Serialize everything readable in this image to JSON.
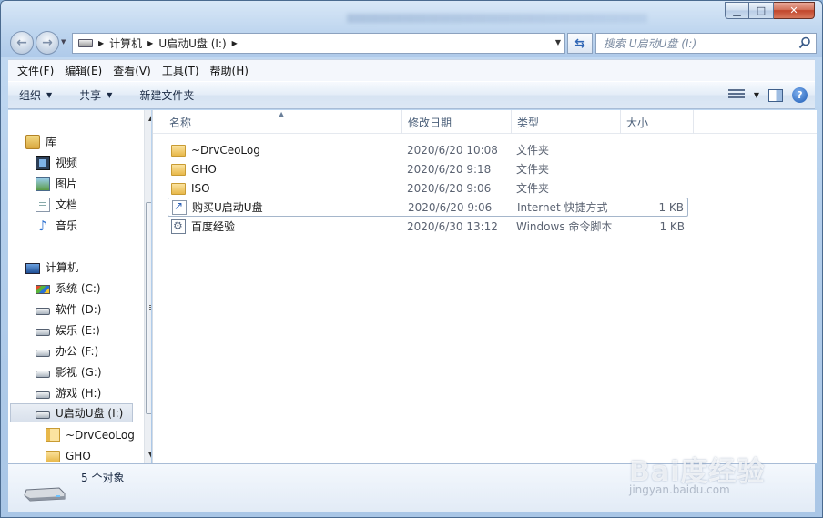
{
  "window": {
    "caption": {
      "minimize": "▁",
      "maximize": "□",
      "close": "✕"
    }
  },
  "navigation": {
    "address_segments": [
      "计算机",
      "U启动U盘 (I:)"
    ],
    "search_placeholder": "搜索 U启动U盘 (I:)"
  },
  "menu": [
    "文件(F)",
    "编辑(E)",
    "查看(V)",
    "工具(T)",
    "帮助(H)"
  ],
  "toolbar": {
    "organize": "组织",
    "share": "共享",
    "new_folder": "新建文件夹"
  },
  "tree": {
    "libraries": "库",
    "library_items": [
      "视频",
      "图片",
      "文档",
      "音乐"
    ],
    "computer": "计算机",
    "drives": [
      "系统 (C:)",
      "软件 (D:)",
      "娱乐 (E:)",
      "办公 (F:)",
      "影视 (G:)",
      "游戏 (H:)"
    ],
    "selected_drive": "U启动U盘 (I:)",
    "subfolders": [
      "~DrvCeoLog",
      "GHO"
    ]
  },
  "columns": {
    "name": "名称",
    "date": "修改日期",
    "type": "类型",
    "size": "大小"
  },
  "files": [
    {
      "name": "~DrvCeoLog",
      "date": "2020/6/20 10:08",
      "type": "文件夹",
      "size": "",
      "icon": "folder-icon"
    },
    {
      "name": "GHO",
      "date": "2020/6/20 9:18",
      "type": "文件夹",
      "size": "",
      "icon": "folder-icon"
    },
    {
      "name": "ISO",
      "date": "2020/6/20 9:06",
      "type": "文件夹",
      "size": "",
      "icon": "folder-icon"
    },
    {
      "name": "购买U启动U盘",
      "date": "2020/6/20 9:06",
      "type": "Internet 快捷方式",
      "size": "1 KB",
      "icon": "internet-shortcut-icon"
    },
    {
      "name": "百度经验",
      "date": "2020/6/30 13:12",
      "type": "Windows 命令脚本",
      "size": "1 KB",
      "icon": "command-script-icon"
    }
  ],
  "status": {
    "item_count": "5 个对象"
  },
  "watermark": {
    "main": "Bai度经验",
    "sub": "jingyan.baidu.com"
  }
}
